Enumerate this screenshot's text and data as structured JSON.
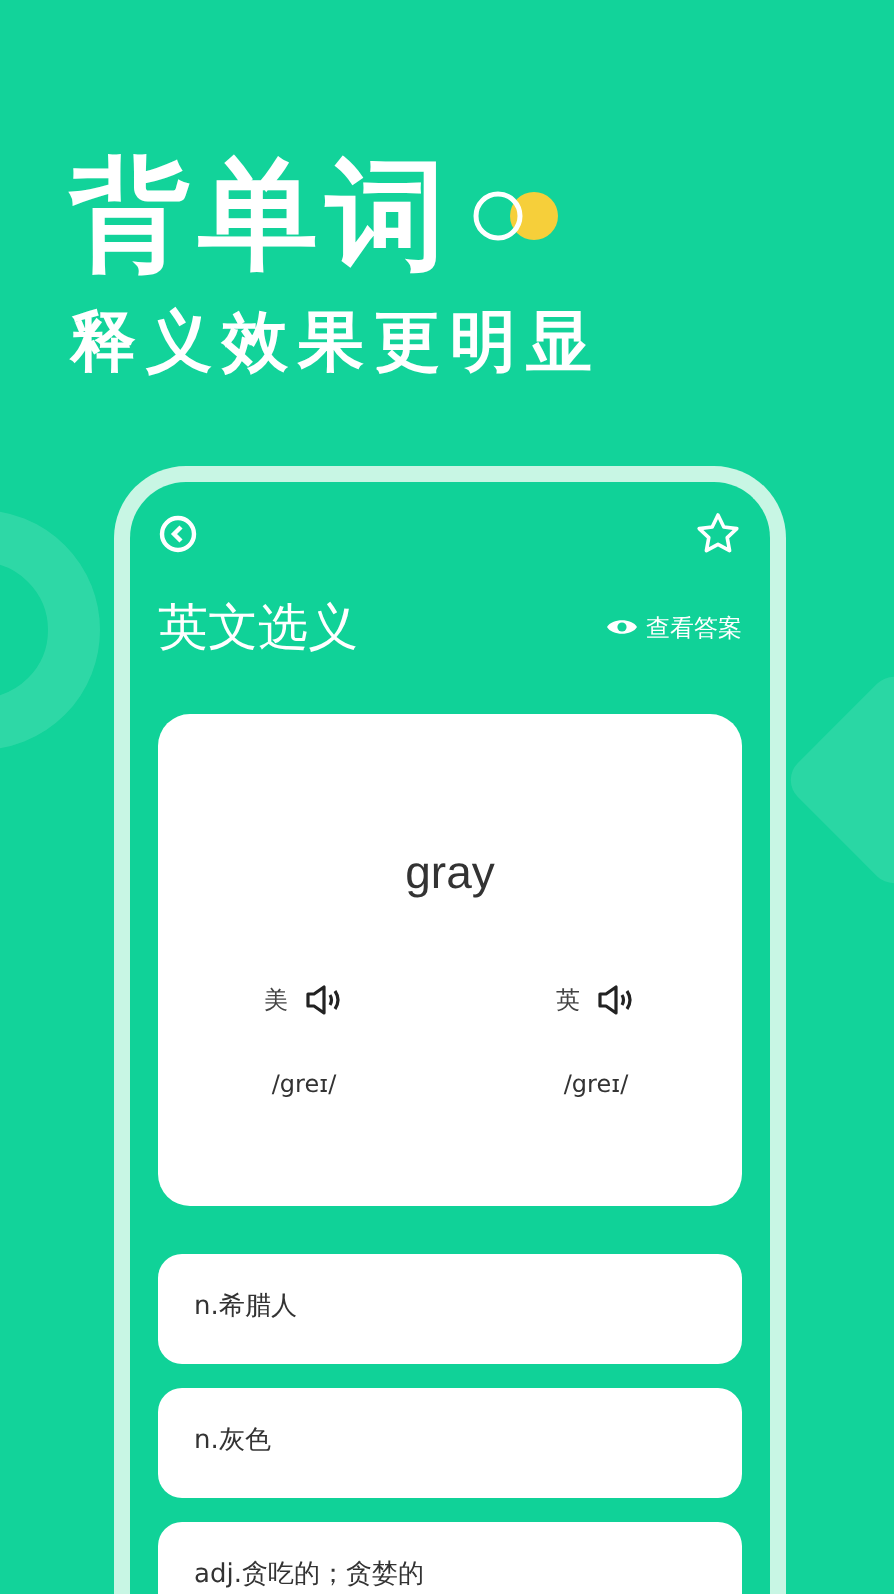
{
  "headline": "背单词",
  "subtitle": "释义效果更明显",
  "screen": {
    "title": "英文选义",
    "show_answer": "查看答案",
    "word": "gray",
    "pronunciations": [
      {
        "label": "美",
        "phonetic": "/greɪ/"
      },
      {
        "label": "英",
        "phonetic": "/greɪ/"
      }
    ],
    "options": [
      {
        "text": "n.希腊人"
      },
      {
        "text": "n.灰色"
      },
      {
        "text": "adj.贪吃的；贪婪的"
      }
    ]
  }
}
